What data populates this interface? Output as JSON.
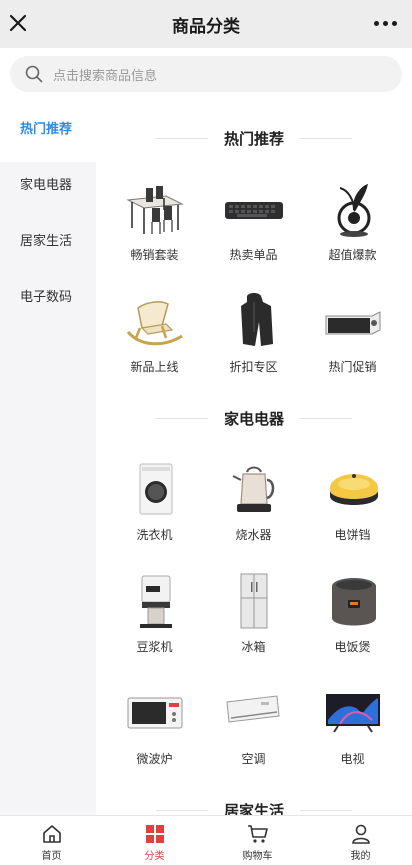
{
  "header": {
    "title": "商品分类",
    "close_icon": "close-icon",
    "more_icon": "more-dots-icon"
  },
  "search": {
    "placeholder": "点击搜索商品信息",
    "icon": "search-icon"
  },
  "sidebar": {
    "items": [
      {
        "label": "热门推荐",
        "active": true
      },
      {
        "label": "家电电器",
        "active": false
      },
      {
        "label": "居家生活",
        "active": false
      },
      {
        "label": "电子数码",
        "active": false
      }
    ]
  },
  "sections": [
    {
      "title": "热门推荐",
      "products": [
        {
          "label": "畅销套装",
          "icon": "dining-table-icon"
        },
        {
          "label": "热卖单品",
          "icon": "keyboard-icon"
        },
        {
          "label": "超值爆款",
          "icon": "fan-icon"
        },
        {
          "label": "新品上线",
          "icon": "rocking-chair-icon"
        },
        {
          "label": "折扣专区",
          "icon": "jacket-icon"
        },
        {
          "label": "热门促销",
          "icon": "projector-icon"
        }
      ]
    },
    {
      "title": "家电电器",
      "products": [
        {
          "label": "洗衣机",
          "icon": "washing-machine-icon"
        },
        {
          "label": "烧水器",
          "icon": "kettle-icon"
        },
        {
          "label": "电饼铛",
          "icon": "griddle-icon"
        },
        {
          "label": "豆浆机",
          "icon": "soymilk-maker-icon"
        },
        {
          "label": "冰箱",
          "icon": "fridge-icon"
        },
        {
          "label": "电饭煲",
          "icon": "rice-cooker-icon"
        },
        {
          "label": "微波炉",
          "icon": "microwave-icon"
        },
        {
          "label": "空调",
          "icon": "air-conditioner-icon"
        },
        {
          "label": "电视",
          "icon": "tv-icon"
        }
      ]
    },
    {
      "title": "居家生活",
      "products": []
    }
  ],
  "tabbar": {
    "tabs": [
      {
        "label": "首页",
        "icon": "home-icon",
        "active": false
      },
      {
        "label": "分类",
        "icon": "category-icon",
        "active": true
      },
      {
        "label": "购物车",
        "icon": "cart-icon",
        "active": false
      },
      {
        "label": "我的",
        "icon": "user-icon",
        "active": false
      }
    ]
  },
  "colors": {
    "accent": "#2b8de3",
    "tab_active": "#e04040",
    "sidebar_bg": "#f5f5f7",
    "header_bg": "#ededed"
  }
}
